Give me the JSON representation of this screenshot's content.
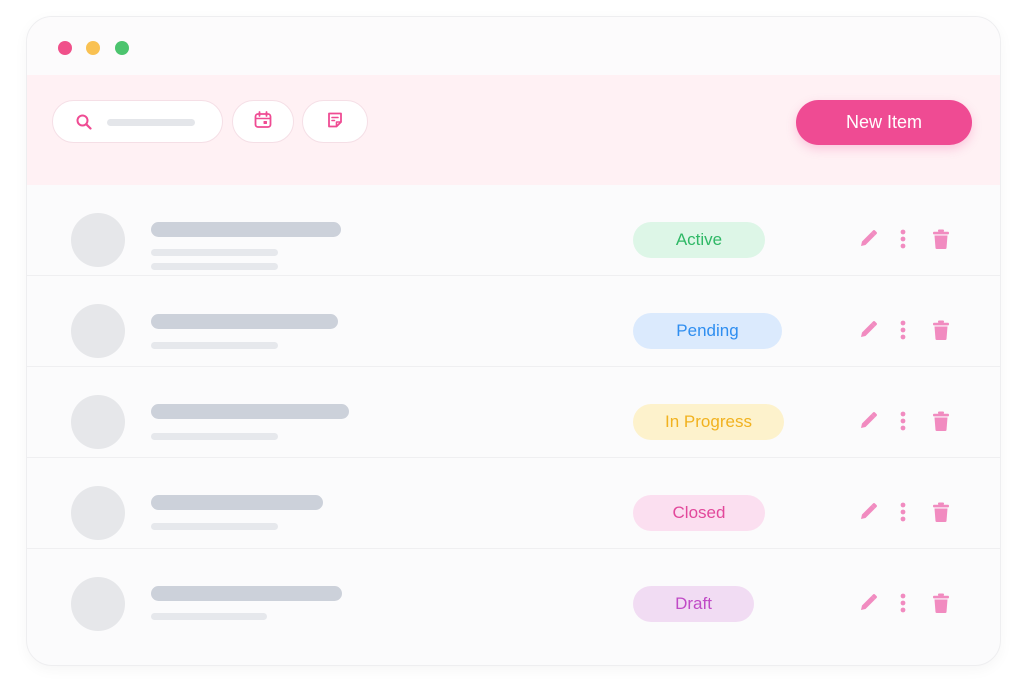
{
  "window": {
    "traffic_lights": [
      {
        "name": "close",
        "color": "#f0508a"
      },
      {
        "name": "minimize",
        "color": "#f9c152"
      },
      {
        "name": "maximize",
        "color": "#4cc46e"
      }
    ]
  },
  "toolbar": {
    "search": {
      "icon": "search-icon",
      "placeholder": ""
    },
    "calendar_icon": "calendar-icon",
    "notes_icon": "note-icon",
    "new_button_label": "New Item",
    "accent": "#ef4b93"
  },
  "rows": [
    {
      "status": "Active",
      "status_color": "#2fb866",
      "status_bg": "#ddf6e7"
    },
    {
      "status": "Pending",
      "status_color": "#2f8ef0",
      "status_bg": "#dbeafd"
    },
    {
      "status": "In Progress",
      "status_color": "#f1b21f",
      "status_bg": "#fdf2cc"
    },
    {
      "status": "Closed",
      "status_color": "#e2489b",
      "status_bg": "#fbdff0"
    },
    {
      "status": "Draft",
      "status_color": "#c04ac6",
      "status_bg": "#f1dcf3"
    }
  ],
  "row_actions": {
    "edit_icon": "pencil-icon",
    "more_icon": "more-vertical-icon",
    "delete_icon": "trash-icon",
    "icon_color": "#f18bc0"
  }
}
